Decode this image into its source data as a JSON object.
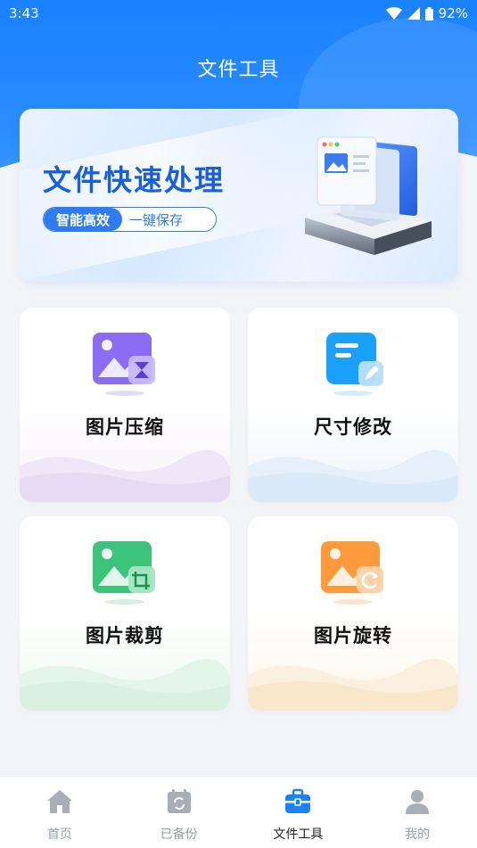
{
  "status_bar": {
    "time": "3:43",
    "battery": "92%"
  },
  "page_title": "文件工具",
  "banner": {
    "title": "文件快速处理",
    "pill_left": "智能高效",
    "pill_right": "一键保存"
  },
  "tools": [
    {
      "label": "图片压缩",
      "icon": "image-compress-icon",
      "color": "#8b6cf5"
    },
    {
      "label": "尺寸修改",
      "icon": "resize-document-icon",
      "color": "#1aa0ff"
    },
    {
      "label": "图片裁剪",
      "icon": "image-crop-icon",
      "color": "#3cc47a"
    },
    {
      "label": "图片旋转",
      "icon": "image-rotate-icon",
      "color": "#ff9a3c"
    }
  ],
  "nav": [
    {
      "label": "首页",
      "icon": "home-icon"
    },
    {
      "label": "已备份",
      "icon": "backup-icon"
    },
    {
      "label": "文件工具",
      "icon": "toolbox-icon",
      "active": true
    },
    {
      "label": "我的",
      "icon": "user-icon"
    }
  ],
  "colors": {
    "primary": "#1a82ff",
    "banner_text": "#1a5fd8"
  }
}
